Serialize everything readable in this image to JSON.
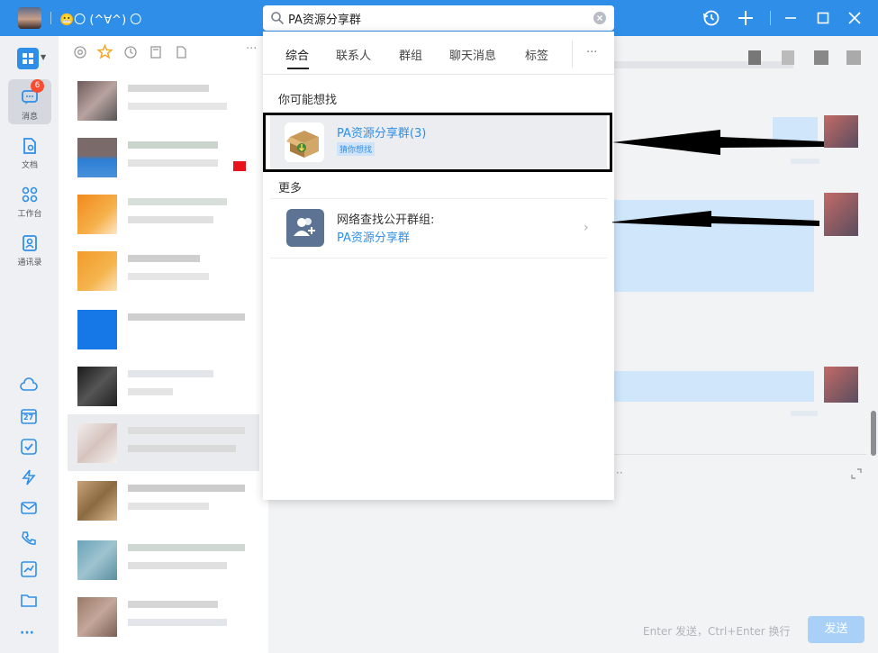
{
  "titlebar": {
    "nickname": "😬〇 (^∀^) 〇",
    "search_value": "PA资源分享群",
    "accent": "#2f8fe8"
  },
  "leftnav": {
    "items": [
      {
        "label": "消息",
        "icon": "chat-icon"
      },
      {
        "label": "文档",
        "icon": "document-icon"
      },
      {
        "label": "工作台",
        "icon": "grid-icon"
      },
      {
        "label": "通讯录",
        "icon": "contacts-icon"
      }
    ],
    "badge": "6",
    "tools": [
      "cloud-icon",
      "calendar-icon",
      "checkbox-icon",
      "lightning-icon",
      "mail-icon",
      "phone-icon",
      "chart-icon",
      "folder-icon",
      "more-icon"
    ],
    "calendar_day": "27"
  },
  "search_dropdown": {
    "tabs": [
      "综合",
      "联系人",
      "群组",
      "聊天消息",
      "标签"
    ],
    "more_tabs": "···",
    "section_suggested": "你可能想找",
    "section_more": "更多",
    "result_1": {
      "name": "PA资源分享群(3)",
      "tag": "猜你想找"
    },
    "result_2": {
      "line1": "网络查找公开群组:",
      "line2": "PA资源分享群"
    }
  },
  "composer": {
    "hint": "Enter 发送，Ctrl+Enter 换行",
    "send_label": "发送"
  }
}
